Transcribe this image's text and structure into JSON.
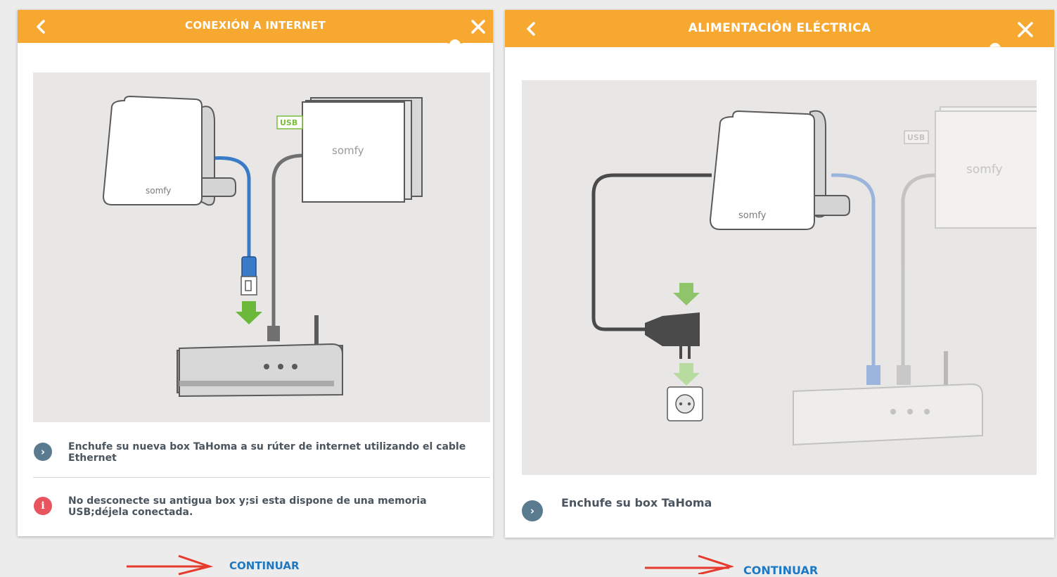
{
  "left_panel": {
    "title": "CONEXIÓN A INTERNET",
    "illustration": {
      "usb_label": "USB",
      "brand_label": "somfy",
      "box_brand_label": "somfy"
    },
    "steps": [
      {
        "icon": "chevron-right-icon",
        "text": "Enchufe su nueva box TaHoma a su rúter de internet utilizando el cable Ethernet"
      },
      {
        "icon": "info-icon",
        "text": "No desconecte su antigua box y;si esta dispone de una memoria USB;déjela conectada."
      }
    ],
    "continue_label": "CONTINUAR"
  },
  "right_panel": {
    "title": "ALIMENTACIÓN ELÉCTRICA",
    "illustration": {
      "usb_label": "USB",
      "brand_label": "somfy",
      "box_brand_label": "somfy"
    },
    "steps": [
      {
        "icon": "chevron-right-icon",
        "text": "Enchufe su box TaHoma"
      }
    ],
    "continue_label": "CONTINUAR"
  },
  "colors": {
    "header": "#f7a831",
    "continue_link": "#1e78c2",
    "annotation_arrow": "#e63a2e",
    "info_icon": "#5a7a8f",
    "warning_icon": "#e8555e"
  }
}
